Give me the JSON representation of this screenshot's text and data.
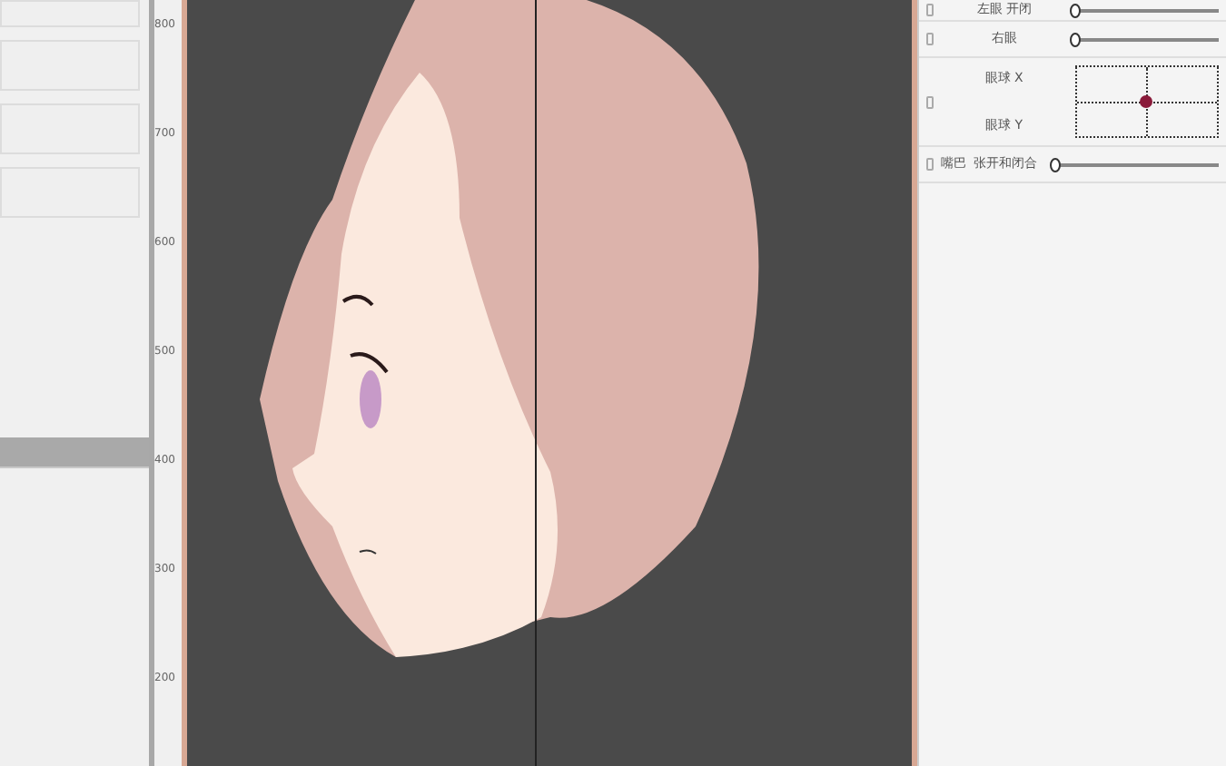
{
  "ruler": {
    "labels": [
      "800",
      "700",
      "600",
      "500",
      "400",
      "300",
      "200"
    ]
  },
  "parameters": [
    {
      "kind": "slider",
      "name": "左眼 开闭",
      "level": 0
    },
    {
      "kind": "slider",
      "name": "右眼",
      "level": 0
    },
    {
      "kind": "pad",
      "axes": [
        {
          "name": "眼球 X",
          "level": 0.5
        },
        {
          "name": "眼球 Y",
          "level": 0.5
        }
      ]
    },
    {
      "kind": "slider",
      "name": "嘴巴",
      "detail": "张开和闭合",
      "level": 0
    }
  ]
}
